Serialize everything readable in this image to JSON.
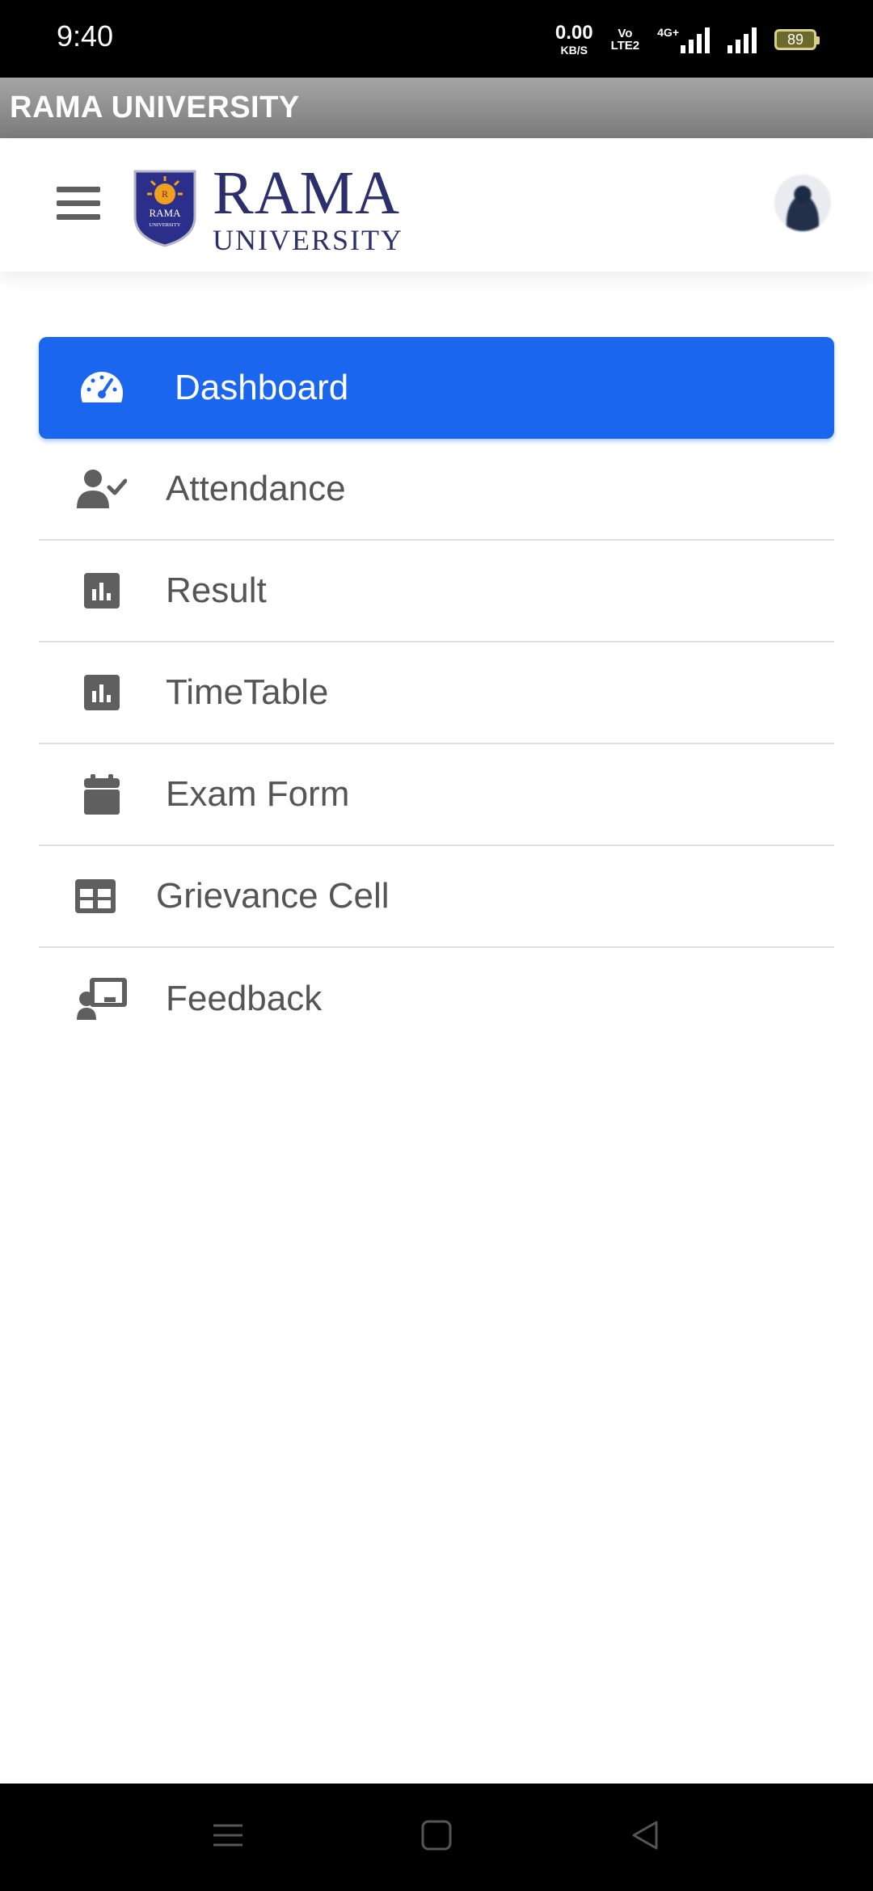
{
  "status": {
    "time": "9:40",
    "net_speed_value": "0.00",
    "net_speed_unit": "KB/S",
    "volte_line1": "Vo",
    "volte_line2": "LTE2",
    "network_type": "4G+",
    "battery": "89"
  },
  "appbar": {
    "title": "RAMA UNIVERSITY"
  },
  "header": {
    "logo_main": "RAMA",
    "logo_sub": "UNIVERSITY",
    "emblem_text": "RAMA",
    "emblem_sub": "UNIVERSITY"
  },
  "menu": {
    "items": [
      {
        "label": "Dashboard",
        "icon": "speedometer-icon",
        "active": true
      },
      {
        "label": "Attendance",
        "icon": "user-check-icon",
        "active": false
      },
      {
        "label": "Result",
        "icon": "bar-chart-icon",
        "active": false
      },
      {
        "label": "TimeTable",
        "icon": "bar-chart-icon",
        "active": false
      },
      {
        "label": "Exam Form",
        "icon": "calendar-icon",
        "active": false
      },
      {
        "label": "Grievance Cell",
        "icon": "table-icon",
        "active": false
      },
      {
        "label": "Feedback",
        "icon": "chalkboard-teacher-icon",
        "active": false
      }
    ]
  },
  "colors": {
    "active_item": "#1a66ee",
    "icon_gray": "#5f5f5f",
    "brand_navy": "#2b2f6b"
  },
  "navbar": {
    "buttons": [
      "menu-icon",
      "home-square-icon",
      "back-triangle-icon"
    ]
  }
}
